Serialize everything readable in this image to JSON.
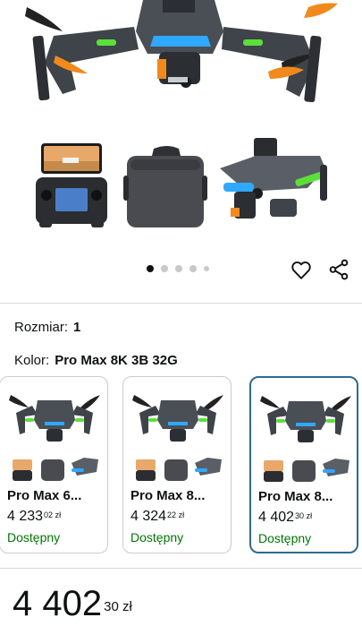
{
  "product": {
    "hero_image": "drone-hero-image",
    "thumbnails": [
      "controller-with-phone-image",
      "carrying-bag-image",
      "drone-angle-image"
    ]
  },
  "carousel": {
    "total_dots": 5,
    "active_index": 0
  },
  "actions": {
    "like_icon": "heart-icon",
    "share_icon": "share-icon"
  },
  "size": {
    "label": "Rozmiar:",
    "value": "1"
  },
  "color": {
    "label": "Kolor:",
    "value": "Pro Max 8K 3B 32G"
  },
  "variants": [
    {
      "title": "Pro Max 6...",
      "price_whole": "4 233",
      "price_fraction": "02",
      "currency": "zł",
      "availability": "Dostępny",
      "selected": false
    },
    {
      "title": "Pro Max 8...",
      "price_whole": "4 324",
      "price_fraction": "22",
      "currency": "zł",
      "availability": "Dostępny",
      "selected": false
    },
    {
      "title": "Pro Max 8...",
      "price_whole": "4 402",
      "price_fraction": "30",
      "currency": "zł",
      "availability": "Dostępny",
      "selected": true
    }
  ],
  "price": {
    "whole": "4 402",
    "fraction": "30",
    "currency": "zł"
  },
  "colors": {
    "available_green": "#007600",
    "selected_border": "#2f6b8e",
    "drone_body": "#4a4e55",
    "accent_green": "#5be03a",
    "accent_orange": "#f08a1c",
    "accent_blue": "#2fa8ff"
  }
}
